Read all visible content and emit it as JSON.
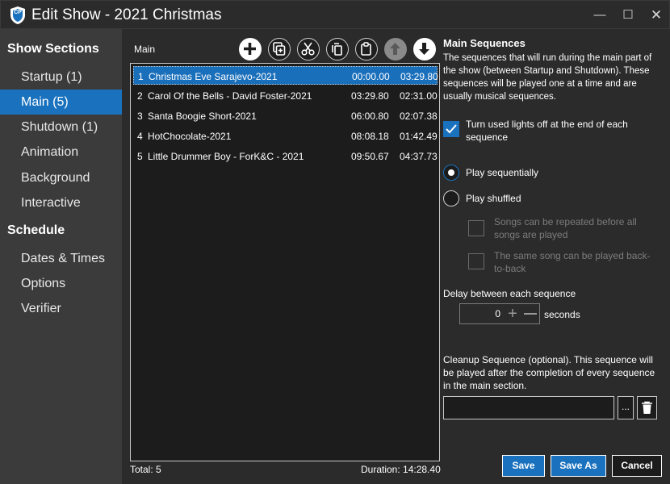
{
  "window": {
    "title": "Edit Show - 2021 Christmas",
    "app_icon": "cp-shield-icon",
    "app_icon_text": "CP",
    "controls": {
      "minimize": "minimize-icon",
      "maximize": "maximize-icon",
      "close": "close-icon"
    }
  },
  "sidebar": {
    "sections": [
      {
        "header": "Show Sections",
        "items": [
          {
            "label": "Startup (1)",
            "active": false
          },
          {
            "label": "Main (5)",
            "active": true
          },
          {
            "label": "Shutdown (1)",
            "active": false
          },
          {
            "label": "Animation",
            "active": false
          },
          {
            "label": "Background",
            "active": false
          },
          {
            "label": "Interactive",
            "active": false
          }
        ]
      },
      {
        "header": "Schedule",
        "items": [
          {
            "label": "Dates & Times",
            "active": false
          },
          {
            "label": "Options",
            "active": false
          },
          {
            "label": "Verifier",
            "active": false
          }
        ]
      }
    ]
  },
  "main_list": {
    "label": "Main",
    "toolbar": [
      "add-icon",
      "duplicate-icon",
      "cut-icon",
      "copy-icon",
      "paste-icon",
      "move-up-icon",
      "move-down-icon"
    ],
    "rows": [
      {
        "num": "1",
        "name": "Christmas Eve Sarajevo-2021",
        "start": "00:00.00",
        "duration": "03:29.80",
        "selected": true
      },
      {
        "num": "2",
        "name": "Carol Of the Bells - David Foster-2021",
        "start": "03:29.80",
        "duration": "02:31.00",
        "selected": false
      },
      {
        "num": "3",
        "name": "Santa Boogie Short-2021",
        "start": "06:00.80",
        "duration": "02:07.38",
        "selected": false
      },
      {
        "num": "4",
        "name": "HotChocolate-2021",
        "start": "08:08.18",
        "duration": "01:42.49",
        "selected": false
      },
      {
        "num": "5",
        "name": "Little Drummer Boy - ForK&C - 2021",
        "start": "09:50.67",
        "duration": "04:37.73",
        "selected": false
      }
    ],
    "total": "Total: 5",
    "duration": "Duration: 14:28.40"
  },
  "panel": {
    "title": "Main Sequences",
    "description": "The sequences that will run during the main part of the show (between Startup and Shutdown). These sequences will be played one at a time and are usually musical sequences.",
    "lights_off_label": "Turn used lights off at the end of each sequence",
    "lights_off_checked": true,
    "play_sequential_label": "Play sequentially",
    "play_shuffled_label": "Play shuffled",
    "play_mode": "sequential",
    "repeat_label": "Songs can be repeated before all songs are played",
    "back_to_back_label": "The same song can be played back-to-back",
    "delay_label": "Delay between each sequence",
    "delay_value": "0",
    "delay_unit": "seconds",
    "cleanup_label": "Cleanup Sequence (optional). This sequence will be played after the completion of every sequence in the main section.",
    "cleanup_value": "",
    "browse_label": "..."
  },
  "buttons": {
    "save": "Save",
    "save_as": "Save As",
    "cancel": "Cancel"
  },
  "colors": {
    "accent": "#1a72be",
    "background": "#2b2b2b",
    "sidebar": "#3b3b3b",
    "list_bg": "#1c1c1c"
  }
}
